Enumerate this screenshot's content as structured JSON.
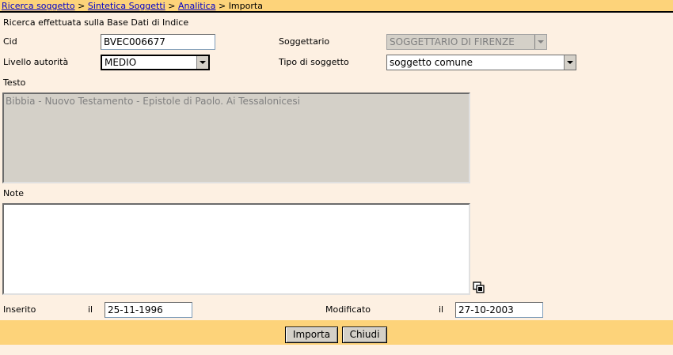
{
  "breadcrumb": {
    "items": [
      "Ricerca soggetto",
      "Sintetica Soggetti",
      "Analitica"
    ],
    "separator": ">",
    "current": "Importa"
  },
  "info_text": "Ricerca effettuata sulla Base Dati di Indice",
  "form": {
    "cid": {
      "label": "Cid",
      "value": "BVEC006677"
    },
    "soggettario": {
      "label": "Soggettario",
      "value": "SOGGETTARIO DI FIRENZE"
    },
    "livello_autorita": {
      "label": "Livello autorità",
      "value": "MEDIO"
    },
    "tipo_soggetto": {
      "label": "Tipo di soggetto",
      "value": "soggetto comune"
    },
    "testo": {
      "label": "Testo",
      "value": "Bibbia - Nuovo Testamento - Epistole di Paolo. Ai Tessalonicesi"
    },
    "note": {
      "label": "Note",
      "value": ""
    },
    "inserito": {
      "label": "Inserito",
      "il": "il",
      "value": "25-11-1996"
    },
    "modificato": {
      "label": "Modificato",
      "il": "il",
      "value": "27-10-2003"
    }
  },
  "buttons": {
    "importa": "Importa",
    "chiudi": "Chiudi"
  },
  "icons": {
    "copy": "copy-icon"
  },
  "colors": {
    "header_bg": "#fdd37a",
    "page_bg": "#fdf0e2",
    "link": "#0000cc"
  }
}
